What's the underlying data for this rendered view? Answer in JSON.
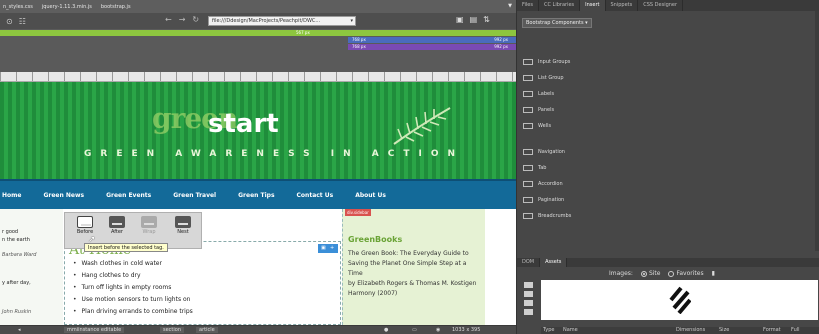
{
  "file_tabs": [
    "n_styles.css",
    "jquery-1.11.3.min.js",
    "bootstrap.js"
  ],
  "address_bar": {
    "url": "file:///Ddesign/MacProjects/Peachpit/DWC..."
  },
  "media_queries": {
    "green": "567 px",
    "blue_left": "768 px",
    "blue_right": "992 px",
    "purple_left": "768 px",
    "purple_right": "992 px"
  },
  "banner": {
    "logo_green": "green",
    "logo_start": "start",
    "tagline": "GREEN AWARENESS IN ACTION"
  },
  "nav": [
    "Home",
    "Green News",
    "Green Events",
    "Green Travel",
    "Green Tips",
    "Contact Us",
    "About Us"
  ],
  "left_column": {
    "line1": "r good",
    "line2": "n the earth",
    "author": "Barbara Ward",
    "line3": "y after day,",
    "author2": "John Ruskin"
  },
  "main": {
    "heading": "At Home",
    "items": [
      "Wash clothes in cold water",
      "Hang clothes to dry",
      "Turn off lights in empty rooms",
      "Use motion sensors to turn lights on",
      "Plan driving errands to combine trips"
    ]
  },
  "sidebar": {
    "tag": "div.sidebar",
    "title": "GreenBooks",
    "text": "The Green Book: The Everyday Guide to Saving the Planet One Simple Step at a Time",
    "author": "by Elizabeth Rogers & Thomas M. Kostigen",
    "publisher": "Harmony (2007)"
  },
  "insert_popup": {
    "before": "Before",
    "after": "After",
    "wrap": "Wrap",
    "nest": "Nest",
    "tooltip": "Insert before the selected tag."
  },
  "status_bar": {
    "crumb1": "mmiinstance editable",
    "crumb2": "section",
    "crumb3": "article",
    "size": "1033 x 395"
  },
  "panel": {
    "tabs": [
      "Files",
      "CC Libraries",
      "Insert",
      "Snippets",
      "CSS Designer"
    ],
    "category": "Bootstrap Components",
    "items": [
      "Input Groups",
      "List Group",
      "Labels",
      "Panels",
      "Wells",
      "",
      "Navigation",
      "Tab",
      "Accordion",
      "Pagination",
      "Breadcrumbs"
    ]
  },
  "assets": {
    "tabs": [
      "DOM",
      "Assets"
    ],
    "images_label": "Images:",
    "site": "Site",
    "favorites": "Favorites",
    "columns": [
      "Type",
      "Name",
      "Dimensions",
      "Size",
      "Format",
      "Full"
    ]
  }
}
